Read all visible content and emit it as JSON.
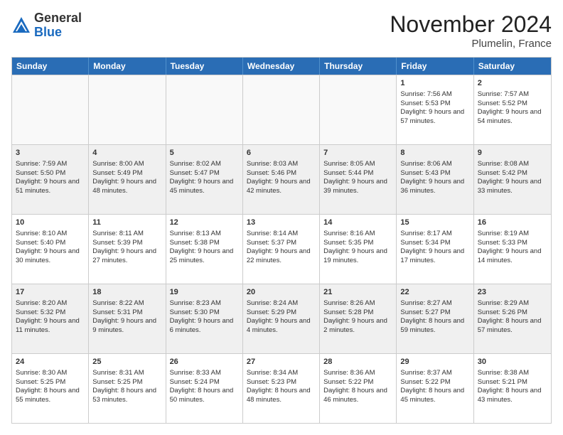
{
  "logo": {
    "general": "General",
    "blue": "Blue"
  },
  "header": {
    "month": "November 2024",
    "location": "Plumelin, France"
  },
  "days": [
    "Sunday",
    "Monday",
    "Tuesday",
    "Wednesday",
    "Thursday",
    "Friday",
    "Saturday"
  ],
  "weeks": [
    [
      {
        "day": "",
        "empty": true
      },
      {
        "day": "",
        "empty": true
      },
      {
        "day": "",
        "empty": true
      },
      {
        "day": "",
        "empty": true
      },
      {
        "day": "",
        "empty": true
      },
      {
        "day": "1",
        "sunrise": "Sunrise: 7:56 AM",
        "sunset": "Sunset: 5:53 PM",
        "daylight": "Daylight: 9 hours and 57 minutes."
      },
      {
        "day": "2",
        "sunrise": "Sunrise: 7:57 AM",
        "sunset": "Sunset: 5:52 PM",
        "daylight": "Daylight: 9 hours and 54 minutes."
      }
    ],
    [
      {
        "day": "3",
        "sunrise": "Sunrise: 7:59 AM",
        "sunset": "Sunset: 5:50 PM",
        "daylight": "Daylight: 9 hours and 51 minutes."
      },
      {
        "day": "4",
        "sunrise": "Sunrise: 8:00 AM",
        "sunset": "Sunset: 5:49 PM",
        "daylight": "Daylight: 9 hours and 48 minutes."
      },
      {
        "day": "5",
        "sunrise": "Sunrise: 8:02 AM",
        "sunset": "Sunset: 5:47 PM",
        "daylight": "Daylight: 9 hours and 45 minutes."
      },
      {
        "day": "6",
        "sunrise": "Sunrise: 8:03 AM",
        "sunset": "Sunset: 5:46 PM",
        "daylight": "Daylight: 9 hours and 42 minutes."
      },
      {
        "day": "7",
        "sunrise": "Sunrise: 8:05 AM",
        "sunset": "Sunset: 5:44 PM",
        "daylight": "Daylight: 9 hours and 39 minutes."
      },
      {
        "day": "8",
        "sunrise": "Sunrise: 8:06 AM",
        "sunset": "Sunset: 5:43 PM",
        "daylight": "Daylight: 9 hours and 36 minutes."
      },
      {
        "day": "9",
        "sunrise": "Sunrise: 8:08 AM",
        "sunset": "Sunset: 5:42 PM",
        "daylight": "Daylight: 9 hours and 33 minutes."
      }
    ],
    [
      {
        "day": "10",
        "sunrise": "Sunrise: 8:10 AM",
        "sunset": "Sunset: 5:40 PM",
        "daylight": "Daylight: 9 hours and 30 minutes."
      },
      {
        "day": "11",
        "sunrise": "Sunrise: 8:11 AM",
        "sunset": "Sunset: 5:39 PM",
        "daylight": "Daylight: 9 hours and 27 minutes."
      },
      {
        "day": "12",
        "sunrise": "Sunrise: 8:13 AM",
        "sunset": "Sunset: 5:38 PM",
        "daylight": "Daylight: 9 hours and 25 minutes."
      },
      {
        "day": "13",
        "sunrise": "Sunrise: 8:14 AM",
        "sunset": "Sunset: 5:37 PM",
        "daylight": "Daylight: 9 hours and 22 minutes."
      },
      {
        "day": "14",
        "sunrise": "Sunrise: 8:16 AM",
        "sunset": "Sunset: 5:35 PM",
        "daylight": "Daylight: 9 hours and 19 minutes."
      },
      {
        "day": "15",
        "sunrise": "Sunrise: 8:17 AM",
        "sunset": "Sunset: 5:34 PM",
        "daylight": "Daylight: 9 hours and 17 minutes."
      },
      {
        "day": "16",
        "sunrise": "Sunrise: 8:19 AM",
        "sunset": "Sunset: 5:33 PM",
        "daylight": "Daylight: 9 hours and 14 minutes."
      }
    ],
    [
      {
        "day": "17",
        "sunrise": "Sunrise: 8:20 AM",
        "sunset": "Sunset: 5:32 PM",
        "daylight": "Daylight: 9 hours and 11 minutes."
      },
      {
        "day": "18",
        "sunrise": "Sunrise: 8:22 AM",
        "sunset": "Sunset: 5:31 PM",
        "daylight": "Daylight: 9 hours and 9 minutes."
      },
      {
        "day": "19",
        "sunrise": "Sunrise: 8:23 AM",
        "sunset": "Sunset: 5:30 PM",
        "daylight": "Daylight: 9 hours and 6 minutes."
      },
      {
        "day": "20",
        "sunrise": "Sunrise: 8:24 AM",
        "sunset": "Sunset: 5:29 PM",
        "daylight": "Daylight: 9 hours and 4 minutes."
      },
      {
        "day": "21",
        "sunrise": "Sunrise: 8:26 AM",
        "sunset": "Sunset: 5:28 PM",
        "daylight": "Daylight: 9 hours and 2 minutes."
      },
      {
        "day": "22",
        "sunrise": "Sunrise: 8:27 AM",
        "sunset": "Sunset: 5:27 PM",
        "daylight": "Daylight: 8 hours and 59 minutes."
      },
      {
        "day": "23",
        "sunrise": "Sunrise: 8:29 AM",
        "sunset": "Sunset: 5:26 PM",
        "daylight": "Daylight: 8 hours and 57 minutes."
      }
    ],
    [
      {
        "day": "24",
        "sunrise": "Sunrise: 8:30 AM",
        "sunset": "Sunset: 5:25 PM",
        "daylight": "Daylight: 8 hours and 55 minutes."
      },
      {
        "day": "25",
        "sunrise": "Sunrise: 8:31 AM",
        "sunset": "Sunset: 5:25 PM",
        "daylight": "Daylight: 8 hours and 53 minutes."
      },
      {
        "day": "26",
        "sunrise": "Sunrise: 8:33 AM",
        "sunset": "Sunset: 5:24 PM",
        "daylight": "Daylight: 8 hours and 50 minutes."
      },
      {
        "day": "27",
        "sunrise": "Sunrise: 8:34 AM",
        "sunset": "Sunset: 5:23 PM",
        "daylight": "Daylight: 8 hours and 48 minutes."
      },
      {
        "day": "28",
        "sunrise": "Sunrise: 8:36 AM",
        "sunset": "Sunset: 5:22 PM",
        "daylight": "Daylight: 8 hours and 46 minutes."
      },
      {
        "day": "29",
        "sunrise": "Sunrise: 8:37 AM",
        "sunset": "Sunset: 5:22 PM",
        "daylight": "Daylight: 8 hours and 45 minutes."
      },
      {
        "day": "30",
        "sunrise": "Sunrise: 8:38 AM",
        "sunset": "Sunset: 5:21 PM",
        "daylight": "Daylight: 8 hours and 43 minutes."
      }
    ]
  ]
}
